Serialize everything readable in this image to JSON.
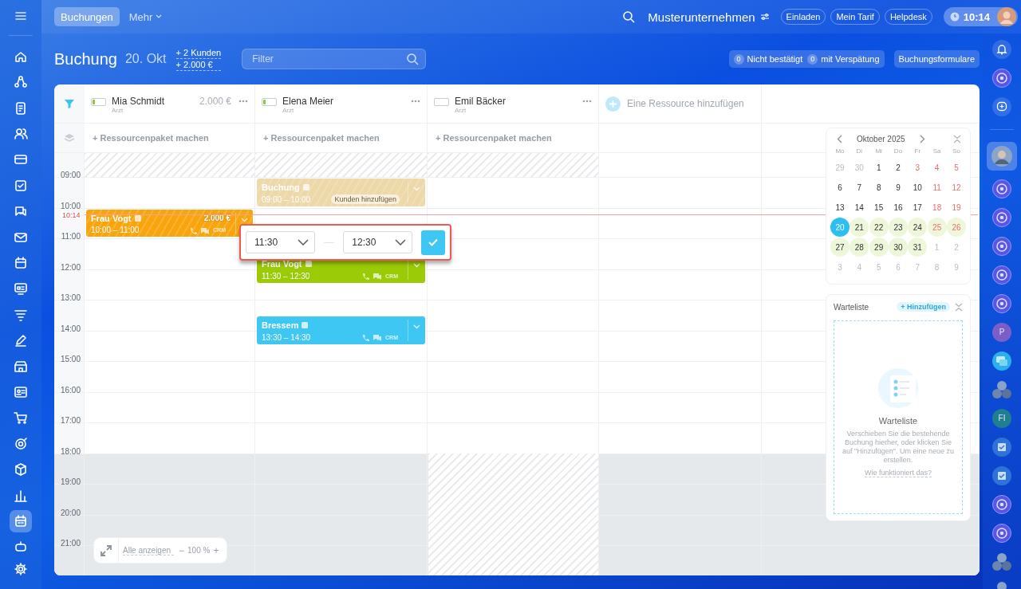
{
  "topbar": {
    "tabs": [
      {
        "label": "Buchungen",
        "selected": true
      },
      {
        "label": "Mehr",
        "selected": false
      }
    ],
    "company": "Musterunternehmen",
    "buttons": [
      "Einladen",
      "Mein Tarif",
      "Helpdesk"
    ],
    "clock": "10:14"
  },
  "sidebar": {
    "items": [
      {
        "selected": false
      },
      {
        "selected": false
      },
      {
        "selected": false
      },
      {
        "selected": false
      },
      {
        "selected": false
      },
      {
        "selected": false
      },
      {
        "selected": false
      },
      {
        "selected": false
      },
      {
        "selected": false
      },
      {
        "selected": false
      },
      {
        "selected": false
      },
      {
        "selected": false
      },
      {
        "selected": false
      },
      {
        "selected": false
      },
      {
        "selected": false
      },
      {
        "selected": false
      },
      {
        "selected": false
      },
      {
        "selected": false
      },
      {
        "selected": true
      },
      {
        "selected": false
      }
    ]
  },
  "page": {
    "title": "Buchung",
    "date": "20. Okt",
    "summary": [
      "+ 2 Kunden",
      "+ 2.000 €"
    ],
    "filter": {
      "placeholder": "Filter"
    },
    "counters": [
      {
        "count": "0",
        "label": "Nicht bestätigt"
      },
      {
        "count": "0",
        "label": "mit Verspätung"
      }
    ],
    "forms_button": "Buchungsformulare"
  },
  "resources": [
    {
      "name": "Mia Schmidt",
      "role": "Arzt",
      "amount": "2.000 €",
      "level": 0.2,
      "package": "+ Ressourcenpaket machen",
      "evening_blocked": false,
      "bookings": [
        {
          "title": "Frau Vogt",
          "time": "10:00 – 11:00",
          "amount": "2.000 €",
          "color": "#f8a40c",
          "striped": true,
          "crm": "CRM"
        }
      ]
    },
    {
      "name": "Elena Meier",
      "role": "Arzt",
      "level": 0.2,
      "package": "+ Ressourcenpaket machen",
      "evening_blocked": false,
      "bookings": [
        {
          "title": "Buchung",
          "time": "09:00 – 10:00",
          "color": "#edd8a9",
          "striped": true,
          "chip": "Kunden hinzufügen"
        },
        {
          "title": "Frau Vogt",
          "time": "11:30 – 12:30",
          "color": "#9bcb06",
          "striped": false,
          "crm": "CRM"
        },
        {
          "title": "Bressem",
          "time": "13:30 – 14:30",
          "color": "#3ec7f3",
          "striped": false,
          "crm": "CRM"
        }
      ]
    },
    {
      "name": "Emil Bäcker",
      "role": "Arzt",
      "level": 0,
      "package": "+ Ressourcenpaket machen",
      "evening_blocked": true
    }
  ],
  "add_resource": "Eine Ressource hinzufügen",
  "hours": [
    {
      "label": "09:00",
      "off": false
    },
    {
      "label": "10:00",
      "off": false
    },
    {
      "label": "11:00",
      "off": false
    },
    {
      "label": "12:00",
      "off": false
    },
    {
      "label": "13:00",
      "off": false
    },
    {
      "label": "14:00",
      "off": false
    },
    {
      "label": "15:00",
      "off": false
    },
    {
      "label": "16:00",
      "off": false
    },
    {
      "label": "17:00",
      "off": false
    },
    {
      "label": "18:00",
      "off": true
    },
    {
      "label": "19:00",
      "off": true
    },
    {
      "label": "20:00",
      "off": true
    },
    {
      "label": "21:00",
      "off": true
    }
  ],
  "now": "10:14",
  "time_popup": {
    "start": "11:30",
    "end": "12:30"
  },
  "calendar": {
    "month": "Oktober 2025",
    "weekdays": [
      "Mo",
      "Di",
      "Mi",
      "Do",
      "Fr",
      "Sa",
      "So"
    ],
    "weeks": [
      [
        {
          "day": "29",
          "muted": true,
          "weekend": false,
          "highlighted": false,
          "selected": false
        },
        {
          "day": "30",
          "muted": true,
          "weekend": false,
          "highlighted": false,
          "selected": false
        },
        {
          "day": "1",
          "muted": false,
          "weekend": false,
          "highlighted": false,
          "selected": false
        },
        {
          "day": "2",
          "muted": false,
          "weekend": false,
          "highlighted": false,
          "selected": false
        },
        {
          "day": "3",
          "muted": false,
          "weekend": true,
          "highlighted": false,
          "selected": false
        },
        {
          "day": "4",
          "muted": false,
          "weekend": true,
          "highlighted": false,
          "selected": false
        },
        {
          "day": "5",
          "muted": false,
          "weekend": true,
          "highlighted": false,
          "selected": false
        }
      ],
      [
        {
          "day": "6",
          "muted": false,
          "weekend": false,
          "highlighted": false,
          "selected": false
        },
        {
          "day": "7",
          "muted": false,
          "weekend": false,
          "highlighted": false,
          "selected": false
        },
        {
          "day": "8",
          "muted": false,
          "weekend": false,
          "highlighted": false,
          "selected": false
        },
        {
          "day": "9",
          "muted": false,
          "weekend": false,
          "highlighted": false,
          "selected": false
        },
        {
          "day": "10",
          "muted": false,
          "weekend": false,
          "highlighted": false,
          "selected": false
        },
        {
          "day": "11",
          "muted": false,
          "weekend": true,
          "highlighted": false,
          "selected": false
        },
        {
          "day": "12",
          "muted": false,
          "weekend": true,
          "highlighted": false,
          "selected": false
        }
      ],
      [
        {
          "day": "13",
          "muted": false,
          "weekend": false,
          "highlighted": false,
          "selected": false
        },
        {
          "day": "14",
          "muted": false,
          "weekend": false,
          "highlighted": false,
          "selected": false
        },
        {
          "day": "15",
          "muted": false,
          "weekend": false,
          "highlighted": false,
          "selected": false
        },
        {
          "day": "16",
          "muted": false,
          "weekend": false,
          "highlighted": false,
          "selected": false
        },
        {
          "day": "17",
          "muted": false,
          "weekend": false,
          "highlighted": false,
          "selected": false
        },
        {
          "day": "18",
          "muted": false,
          "weekend": true,
          "highlighted": false,
          "selected": false
        },
        {
          "day": "19",
          "muted": false,
          "weekend": true,
          "highlighted": false,
          "selected": false
        }
      ],
      [
        {
          "day": "20",
          "muted": false,
          "weekend": false,
          "highlighted": true,
          "selected": true
        },
        {
          "day": "21",
          "muted": false,
          "weekend": false,
          "highlighted": true,
          "selected": false
        },
        {
          "day": "22",
          "muted": false,
          "weekend": false,
          "highlighted": true,
          "selected": false
        },
        {
          "day": "23",
          "muted": false,
          "weekend": false,
          "highlighted": true,
          "selected": false
        },
        {
          "day": "24",
          "muted": false,
          "weekend": false,
          "highlighted": true,
          "selected": false
        },
        {
          "day": "25",
          "muted": false,
          "weekend": true,
          "highlighted": true,
          "selected": false
        },
        {
          "day": "26",
          "muted": false,
          "weekend": true,
          "highlighted": true,
          "selected": false
        }
      ],
      [
        {
          "day": "27",
          "muted": false,
          "weekend": false,
          "highlighted": true,
          "selected": false
        },
        {
          "day": "28",
          "muted": false,
          "weekend": false,
          "highlighted": true,
          "selected": false
        },
        {
          "day": "29",
          "muted": false,
          "weekend": false,
          "highlighted": true,
          "selected": false
        },
        {
          "day": "30",
          "muted": false,
          "weekend": false,
          "highlighted": true,
          "selected": false
        },
        {
          "day": "31",
          "muted": false,
          "weekend": false,
          "highlighted": true,
          "selected": false
        },
        {
          "day": "1",
          "muted": true,
          "weekend": false,
          "highlighted": false,
          "selected": false
        },
        {
          "day": "2",
          "muted": true,
          "weekend": false,
          "highlighted": false,
          "selected": false
        }
      ],
      [
        {
          "day": "3",
          "muted": true,
          "weekend": false,
          "highlighted": false,
          "selected": false
        },
        {
          "day": "4",
          "muted": true,
          "weekend": false,
          "highlighted": false,
          "selected": false
        },
        {
          "day": "5",
          "muted": true,
          "weekend": false,
          "highlighted": false,
          "selected": false
        },
        {
          "day": "6",
          "muted": true,
          "weekend": false,
          "highlighted": false,
          "selected": false
        },
        {
          "day": "7",
          "muted": true,
          "weekend": false,
          "highlighted": false,
          "selected": false
        },
        {
          "day": "8",
          "muted": true,
          "weekend": false,
          "highlighted": false,
          "selected": false
        },
        {
          "day": "9",
          "muted": true,
          "weekend": false,
          "highlighted": false,
          "selected": false
        }
      ]
    ]
  },
  "waitlist": {
    "title": "Warteliste",
    "add": "+ Hinzufügen",
    "empty_title": "Warteliste",
    "empty_text": "Verschieben Sie die bestehende Buchung hierher, oder klicken Sie auf \"Hinzufügen\". Um eine neue zu erstellen.",
    "help_link": "Wie funktioniert das?"
  },
  "zoom": {
    "show_all": "Alle anzeigen",
    "minus": "−",
    "value": "100 %",
    "plus": "+"
  },
  "right_sidebar": {
    "items": [
      {
        "kind": "bell"
      },
      {
        "kind": "ring"
      },
      {
        "kind": "chat-plus"
      },
      {
        "kind": "avatar",
        "selected": true
      },
      {
        "kind": "ring",
        "selected": false
      },
      {
        "kind": "ring",
        "selected": false
      },
      {
        "kind": "ring",
        "selected": false
      },
      {
        "kind": "ring",
        "selected": false
      },
      {
        "kind": "ring",
        "selected": false
      },
      {
        "kind": "initials",
        "text": "P",
        "color": "#7b5fc9"
      },
      {
        "kind": "chat"
      },
      {
        "kind": "group"
      },
      {
        "kind": "initials",
        "text": "FI",
        "color": "#1f7f8f"
      },
      {
        "kind": "check"
      },
      {
        "kind": "check"
      },
      {
        "kind": "ring",
        "selected": false
      },
      {
        "kind": "ring",
        "selected": false
      },
      {
        "kind": "group"
      },
      {
        "kind": "group"
      }
    ]
  }
}
